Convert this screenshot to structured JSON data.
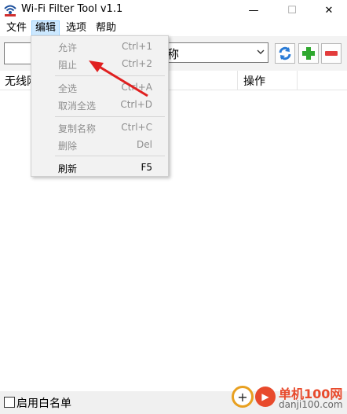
{
  "window": {
    "title": "Wi-Fi Filter Tool v1.1",
    "minimize": "—",
    "maximize": "☐",
    "close": "✕"
  },
  "menubar": {
    "file": "文件",
    "edit": "编辑",
    "options": "选项",
    "help": "帮助"
  },
  "toolbar": {
    "combo_text": "称"
  },
  "list_header": {
    "col1": "无线网",
    "col_action": "操作"
  },
  "edit_menu": {
    "items": [
      {
        "label": "允许",
        "shortcut": "Ctrl+1",
        "enabled": false
      },
      {
        "label": "阻止",
        "shortcut": "Ctrl+2",
        "enabled": false
      },
      {
        "label": "全选",
        "shortcut": "Ctrl+A",
        "enabled": false
      },
      {
        "label": "取消全选",
        "shortcut": "Ctrl+D",
        "enabled": false
      },
      {
        "label": "复制名称",
        "shortcut": "Ctrl+C",
        "enabled": false
      },
      {
        "label": "删除",
        "shortcut": "Del",
        "enabled": false
      },
      {
        "label": "刷新",
        "shortcut": "F5",
        "enabled": true
      }
    ]
  },
  "statusbar": {
    "whitelist_label": "启用白名单",
    "whitelist_checked": false
  },
  "watermark": {
    "title": "单机100网",
    "url": "danji100.com"
  },
  "colors": {
    "menu_highlight": "#cce8ff",
    "refresh_blue": "#2a7bd6",
    "add_green": "#2fa82f",
    "remove_red": "#e23b3b",
    "arrow_red": "#e02020"
  }
}
